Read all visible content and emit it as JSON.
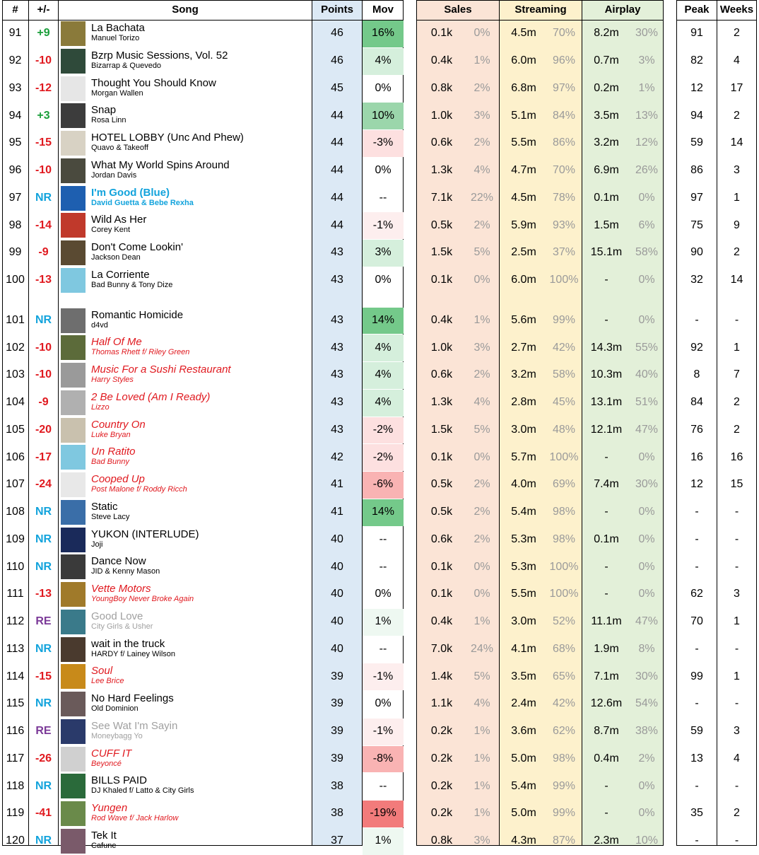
{
  "headers": {
    "rank": "#",
    "change": "+/-",
    "song": "Song",
    "points": "Points",
    "mov": "Mov",
    "sales": "Sales",
    "streaming": "Streaming",
    "airplay": "Airplay",
    "peak": "Peak",
    "weeks": "Weeks"
  },
  "colors": {
    "points_bg": "#dce9f5",
    "sales_bg": "#fbe4d6",
    "streaming_bg": "#fdf1cc",
    "airplay_bg": "#e3f0d9",
    "up": "#1a9e3a",
    "down": "#e0191f",
    "new": "#12a3dc",
    "reentry": "#7b3a98",
    "bullet_title": "#e0191f",
    "highlight_title": "#12a3dc",
    "faded_title": "#a0a0a0",
    "mov_pos_strong": "#74c98a",
    "mov_pos_light": "#d5efdc",
    "mov_neg_strong": "#f27b7b",
    "mov_neg_light": "#fde0e0"
  },
  "rows": [
    {
      "rank": "91",
      "change": "+9",
      "title": "La Bachata",
      "artist": "Manuel Torizo",
      "points": "46",
      "mov": "16%",
      "sales": "0.1k",
      "sales_pct": "0%",
      "stream": "4.5m",
      "stream_pct": "70%",
      "air": "8.2m",
      "air_pct": "30%",
      "peak": "91",
      "weeks": "2",
      "style": "normal",
      "change_type": "up",
      "mov_level": "pos3",
      "art_color": "#8a7a3a"
    },
    {
      "rank": "92",
      "change": "-10",
      "title": "Bzrp Music Sessions, Vol. 52",
      "artist": "Bizarrap & Quevedo",
      "points": "46",
      "mov": "4%",
      "sales": "0.4k",
      "sales_pct": "1%",
      "stream": "6.0m",
      "stream_pct": "96%",
      "air": "0.7m",
      "air_pct": "3%",
      "peak": "82",
      "weeks": "4",
      "style": "normal",
      "change_type": "down",
      "mov_level": "pos1",
      "art_color": "#2f4a3a"
    },
    {
      "rank": "93",
      "change": "-12",
      "title": "Thought You Should Know",
      "artist": "Morgan Wallen",
      "points": "45",
      "mov": "0%",
      "sales": "0.8k",
      "sales_pct": "2%",
      "stream": "6.8m",
      "stream_pct": "97%",
      "air": "0.2m",
      "air_pct": "1%",
      "peak": "12",
      "weeks": "17",
      "style": "normal",
      "change_type": "down",
      "mov_level": "none",
      "art_color": "#e6e6e6"
    },
    {
      "rank": "94",
      "change": "+3",
      "title": "Snap",
      "artist": "Rosa Linn",
      "points": "44",
      "mov": "10%",
      "sales": "1.0k",
      "sales_pct": "3%",
      "stream": "5.1m",
      "stream_pct": "84%",
      "air": "3.5m",
      "air_pct": "13%",
      "peak": "94",
      "weeks": "2",
      "style": "normal",
      "change_type": "up",
      "mov_level": "pos2",
      "art_color": "#3c3c3c"
    },
    {
      "rank": "95",
      "change": "-15",
      "title": "HOTEL LOBBY (Unc And Phew)",
      "artist": "Quavo & Takeoff",
      "points": "44",
      "mov": "-3%",
      "sales": "0.6k",
      "sales_pct": "2%",
      "stream": "5.5m",
      "stream_pct": "86%",
      "air": "3.2m",
      "air_pct": "12%",
      "peak": "59",
      "weeks": "14",
      "style": "normal",
      "change_type": "down",
      "mov_level": "neg1",
      "art_color": "#d8d2c4"
    },
    {
      "rank": "96",
      "change": "-10",
      "title": "What My World Spins Around",
      "artist": "Jordan Davis",
      "points": "44",
      "mov": "0%",
      "sales": "1.3k",
      "sales_pct": "4%",
      "stream": "4.7m",
      "stream_pct": "70%",
      "air": "6.9m",
      "air_pct": "26%",
      "peak": "86",
      "weeks": "3",
      "style": "normal",
      "change_type": "down",
      "mov_level": "none",
      "art_color": "#4a4a3e"
    },
    {
      "rank": "97",
      "change": "NR",
      "title": "I'm Good (Blue)",
      "artist": "David Guetta & Bebe Rexha",
      "points": "44",
      "mov": "--",
      "sales": "7.1k",
      "sales_pct": "22%",
      "stream": "4.5m",
      "stream_pct": "78%",
      "air": "0.1m",
      "air_pct": "0%",
      "peak": "97",
      "weeks": "1",
      "style": "highlight",
      "change_type": "new",
      "mov_level": "none",
      "art_color": "#1e5fb0"
    },
    {
      "rank": "98",
      "change": "-14",
      "title": "Wild As Her",
      "artist": "Corey Kent",
      "points": "44",
      "mov": "-1%",
      "sales": "0.5k",
      "sales_pct": "2%",
      "stream": "5.9m",
      "stream_pct": "93%",
      "air": "1.5m",
      "air_pct": "6%",
      "peak": "75",
      "weeks": "9",
      "style": "normal",
      "change_type": "down",
      "mov_level": "neg0",
      "art_color": "#c0392b"
    },
    {
      "rank": "99",
      "change": "-9",
      "title": "Don't Come Lookin'",
      "artist": "Jackson Dean",
      "points": "43",
      "mov": "3%",
      "sales": "1.5k",
      "sales_pct": "5%",
      "stream": "2.5m",
      "stream_pct": "37%",
      "air": "15.1m",
      "air_pct": "58%",
      "peak": "90",
      "weeks": "2",
      "style": "normal",
      "change_type": "down",
      "mov_level": "pos1",
      "art_color": "#5a4a32"
    },
    {
      "rank": "100",
      "change": "-13",
      "title": "La Corriente",
      "artist": "Bad Bunny & Tony Dize",
      "points": "43",
      "mov": "0%",
      "sales": "0.1k",
      "sales_pct": "0%",
      "stream": "6.0m",
      "stream_pct": "100%",
      "air": "-",
      "air_pct": "0%",
      "peak": "32",
      "weeks": "14",
      "style": "normal",
      "change_type": "down",
      "mov_level": "none",
      "art_color": "#7fc8e0"
    },
    {
      "rank": "101",
      "change": "NR",
      "title": "Romantic Homicide",
      "artist": "d4vd",
      "points": "43",
      "mov": "14%",
      "sales": "0.4k",
      "sales_pct": "1%",
      "stream": "5.6m",
      "stream_pct": "99%",
      "air": "-",
      "air_pct": "0%",
      "peak": "-",
      "weeks": "-",
      "style": "normal",
      "change_type": "new",
      "mov_level": "pos3",
      "art_color": "#6e6e6e"
    },
    {
      "rank": "102",
      "change": "-10",
      "title": "Half Of Me",
      "artist": "Thomas Rhett f/ Riley Green",
      "points": "43",
      "mov": "4%",
      "sales": "1.0k",
      "sales_pct": "3%",
      "stream": "2.7m",
      "stream_pct": "42%",
      "air": "14.3m",
      "air_pct": "55%",
      "peak": "92",
      "weeks": "1",
      "style": "bullet",
      "change_type": "down",
      "mov_level": "pos1",
      "art_color": "#5c6b3a"
    },
    {
      "rank": "103",
      "change": "-10",
      "title": "Music For a Sushi Restaurant",
      "artist": "Harry Styles",
      "points": "43",
      "mov": "4%",
      "sales": "0.6k",
      "sales_pct": "2%",
      "stream": "3.2m",
      "stream_pct": "58%",
      "air": "10.3m",
      "air_pct": "40%",
      "peak": "8",
      "weeks": "7",
      "style": "bullet",
      "change_type": "down",
      "mov_level": "pos1",
      "art_color": "#9a9a9a"
    },
    {
      "rank": "104",
      "change": "-9",
      "title": "2 Be Loved (Am I Ready)",
      "artist": "Lizzo",
      "points": "43",
      "mov": "4%",
      "sales": "1.3k",
      "sales_pct": "4%",
      "stream": "2.8m",
      "stream_pct": "45%",
      "air": "13.1m",
      "air_pct": "51%",
      "peak": "84",
      "weeks": "2",
      "style": "bullet",
      "change_type": "down",
      "mov_level": "pos1",
      "art_color": "#b0b0b0"
    },
    {
      "rank": "105",
      "change": "-20",
      "title": "Country On",
      "artist": "Luke Bryan",
      "points": "43",
      "mov": "-2%",
      "sales": "1.5k",
      "sales_pct": "5%",
      "stream": "3.0m",
      "stream_pct": "48%",
      "air": "12.1m",
      "air_pct": "47%",
      "peak": "76",
      "weeks": "2",
      "style": "bullet",
      "change_type": "down",
      "mov_level": "neg1",
      "art_color": "#c9c1ae"
    },
    {
      "rank": "106",
      "change": "-17",
      "title": "Un Ratito",
      "artist": "Bad Bunny",
      "points": "42",
      "mov": "-2%",
      "sales": "0.1k",
      "sales_pct": "0%",
      "stream": "5.7m",
      "stream_pct": "100%",
      "air": "-",
      "air_pct": "0%",
      "peak": "16",
      "weeks": "16",
      "style": "bullet",
      "change_type": "down",
      "mov_level": "neg1",
      "art_color": "#7fc8e0"
    },
    {
      "rank": "107",
      "change": "-24",
      "title": "Cooped Up",
      "artist": "Post Malone f/ Roddy Ricch",
      "points": "41",
      "mov": "-6%",
      "sales": "0.5k",
      "sales_pct": "2%",
      "stream": "4.0m",
      "stream_pct": "69%",
      "air": "7.4m",
      "air_pct": "30%",
      "peak": "12",
      "weeks": "15",
      "style": "bullet",
      "change_type": "down",
      "mov_level": "neg2",
      "art_color": "#e8e8e8"
    },
    {
      "rank": "108",
      "change": "NR",
      "title": "Static",
      "artist": "Steve Lacy",
      "points": "41",
      "mov": "14%",
      "sales": "0.5k",
      "sales_pct": "2%",
      "stream": "5.4m",
      "stream_pct": "98%",
      "air": "-",
      "air_pct": "0%",
      "peak": "-",
      "weeks": "-",
      "style": "normal",
      "change_type": "new",
      "mov_level": "pos3",
      "art_color": "#3a6ea8"
    },
    {
      "rank": "109",
      "change": "NR",
      "title": "YUKON (INTERLUDE)",
      "artist": "Joji",
      "points": "40",
      "mov": "--",
      "sales": "0.6k",
      "sales_pct": "2%",
      "stream": "5.3m",
      "stream_pct": "98%",
      "air": "0.1m",
      "air_pct": "0%",
      "peak": "-",
      "weeks": "-",
      "style": "normal",
      "change_type": "new",
      "mov_level": "none",
      "art_color": "#1a2a5a"
    },
    {
      "rank": "110",
      "change": "NR",
      "title": "Dance Now",
      "artist": "JID & Kenny Mason",
      "points": "40",
      "mov": "--",
      "sales": "0.1k",
      "sales_pct": "0%",
      "stream": "5.3m",
      "stream_pct": "100%",
      "air": "-",
      "air_pct": "0%",
      "peak": "-",
      "weeks": "-",
      "style": "normal",
      "change_type": "new",
      "mov_level": "none",
      "art_color": "#3a3a3a"
    },
    {
      "rank": "111",
      "change": "-13",
      "title": "Vette Motors",
      "artist": "YoungBoy Never Broke Again",
      "points": "40",
      "mov": "0%",
      "sales": "0.1k",
      "sales_pct": "0%",
      "stream": "5.5m",
      "stream_pct": "100%",
      "air": "-",
      "air_pct": "0%",
      "peak": "62",
      "weeks": "3",
      "style": "bullet",
      "change_type": "down",
      "mov_level": "none",
      "art_color": "#a07a2a"
    },
    {
      "rank": "112",
      "change": "RE",
      "title": "Good Love",
      "artist": "City Girls & Usher",
      "points": "40",
      "mov": "1%",
      "sales": "0.4k",
      "sales_pct": "1%",
      "stream": "3.0m",
      "stream_pct": "52%",
      "air": "11.1m",
      "air_pct": "47%",
      "peak": "70",
      "weeks": "1",
      "style": "faded",
      "change_type": "reentry",
      "mov_level": "pos0",
      "art_color": "#3a7a8a"
    },
    {
      "rank": "113",
      "change": "NR",
      "title": "wait in the truck",
      "artist": "HARDY f/ Lainey Wilson",
      "points": "40",
      "mov": "--",
      "sales": "7.0k",
      "sales_pct": "24%",
      "stream": "4.1m",
      "stream_pct": "68%",
      "air": "1.9m",
      "air_pct": "8%",
      "peak": "-",
      "weeks": "-",
      "style": "normal",
      "change_type": "new",
      "mov_level": "none",
      "art_color": "#4a3a2e"
    },
    {
      "rank": "114",
      "change": "-15",
      "title": "Soul",
      "artist": "Lee Brice",
      "points": "39",
      "mov": "-1%",
      "sales": "1.4k",
      "sales_pct": "5%",
      "stream": "3.5m",
      "stream_pct": "65%",
      "air": "7.1m",
      "air_pct": "30%",
      "peak": "99",
      "weeks": "1",
      "style": "bullet",
      "change_type": "down",
      "mov_level": "neg0",
      "art_color": "#c88a1a"
    },
    {
      "rank": "115",
      "change": "NR",
      "title": "No Hard Feelings",
      "artist": "Old Dominion",
      "points": "39",
      "mov": "0%",
      "sales": "1.1k",
      "sales_pct": "4%",
      "stream": "2.4m",
      "stream_pct": "42%",
      "air": "12.6m",
      "air_pct": "54%",
      "peak": "-",
      "weeks": "-",
      "style": "normal",
      "change_type": "new",
      "mov_level": "none",
      "art_color": "#6a5a5a"
    },
    {
      "rank": "116",
      "change": "RE",
      "title": "See Wat I'm Sayin",
      "artist": "Moneybagg Yo",
      "points": "39",
      "mov": "-1%",
      "sales": "0.2k",
      "sales_pct": "1%",
      "stream": "3.6m",
      "stream_pct": "62%",
      "air": "8.7m",
      "air_pct": "38%",
      "peak": "59",
      "weeks": "3",
      "style": "faded",
      "change_type": "reentry",
      "mov_level": "neg0",
      "art_color": "#2a3a6a"
    },
    {
      "rank": "117",
      "change": "-26",
      "title": "CUFF IT",
      "artist": "Beyoncé",
      "points": "39",
      "mov": "-8%",
      "sales": "0.2k",
      "sales_pct": "1%",
      "stream": "5.0m",
      "stream_pct": "98%",
      "air": "0.4m",
      "air_pct": "2%",
      "peak": "13",
      "weeks": "4",
      "style": "bullet",
      "change_type": "down",
      "mov_level": "neg2",
      "art_color": "#d0d0d0"
    },
    {
      "rank": "118",
      "change": "NR",
      "title": "BILLS PAID",
      "artist": "DJ Khaled f/ Latto & City Girls",
      "points": "38",
      "mov": "--",
      "sales": "0.2k",
      "sales_pct": "1%",
      "stream": "5.4m",
      "stream_pct": "99%",
      "air": "-",
      "air_pct": "0%",
      "peak": "-",
      "weeks": "-",
      "style": "normal",
      "change_type": "new",
      "mov_level": "none",
      "art_color": "#2a6a3a"
    },
    {
      "rank": "119",
      "change": "-41",
      "title": "Yungen",
      "artist": "Rod Wave f/ Jack Harlow",
      "points": "38",
      "mov": "-19%",
      "sales": "0.2k",
      "sales_pct": "1%",
      "stream": "5.0m",
      "stream_pct": "99%",
      "air": "-",
      "air_pct": "0%",
      "peak": "35",
      "weeks": "2",
      "style": "bullet",
      "change_type": "down",
      "mov_level": "neg3",
      "art_color": "#6a8a4a"
    },
    {
      "rank": "120",
      "change": "NR",
      "title": "Tek It",
      "artist": "Cafune",
      "points": "37",
      "mov": "1%",
      "sales": "0.8k",
      "sales_pct": "3%",
      "stream": "4.3m",
      "stream_pct": "87%",
      "air": "2.3m",
      "air_pct": "10%",
      "peak": "-",
      "weeks": "-",
      "style": "normal",
      "change_type": "new",
      "mov_level": "pos0",
      "art_color": "#7a5a6a"
    }
  ]
}
